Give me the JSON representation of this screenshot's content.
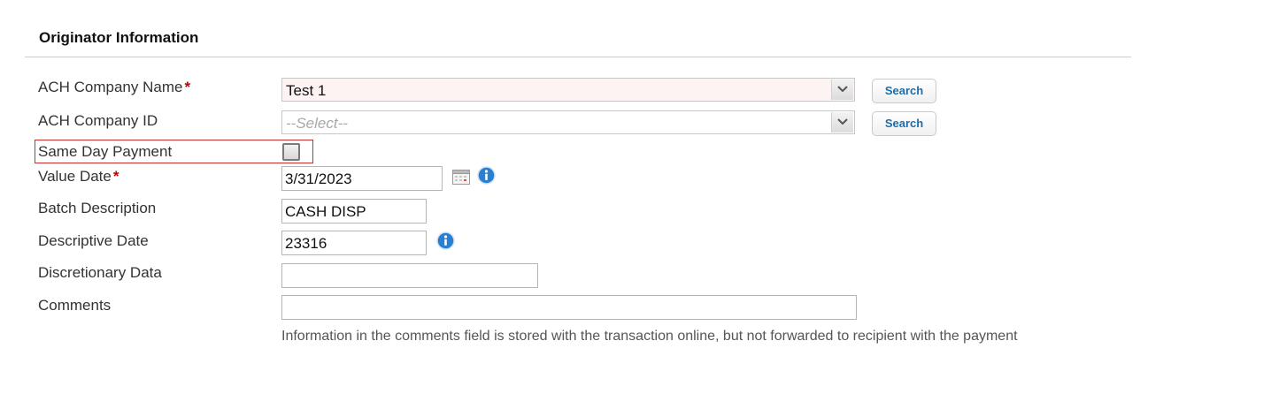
{
  "section": {
    "title": "Originator Information"
  },
  "required_marker": "*",
  "fields": {
    "ach_company_name": {
      "label": "ACH Company Name",
      "value": "Test 1",
      "search_label": "Search"
    },
    "ach_company_id": {
      "label": "ACH Company ID",
      "placeholder": "--Select--",
      "search_label": "Search"
    },
    "same_day_payment": {
      "label": "Same Day Payment",
      "checked": false
    },
    "value_date": {
      "label": "Value Date",
      "value": "3/31/2023"
    },
    "batch_description": {
      "label": "Batch Description",
      "value": "CASH DISP"
    },
    "descriptive_date": {
      "label": "Descriptive Date",
      "value": "23316"
    },
    "discretionary_data": {
      "label": "Discretionary Data",
      "value": ""
    },
    "comments": {
      "label": "Comments",
      "value": "",
      "note": "Information in the comments field is stored with the transaction online, but not forwarded to recipient with the payment"
    }
  },
  "icons": {
    "calendar": "calendar-icon",
    "info": "info-icon",
    "dropdown": "chevron-down-icon"
  },
  "colors": {
    "required": "#c00000",
    "link": "#1e6da8",
    "highlight_border": "#c9302c",
    "info_blue": "#2a7fd0"
  }
}
